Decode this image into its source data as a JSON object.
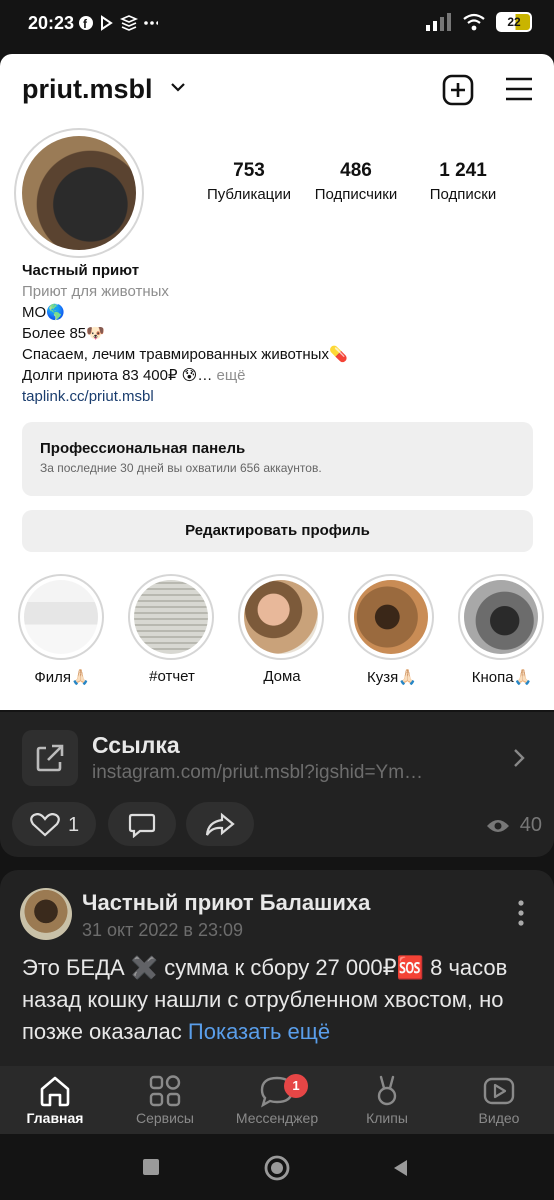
{
  "status_bar": {
    "time": "20:23",
    "battery": "22",
    "icons": [
      "facebook-icon",
      "play-icon",
      "layers-icon",
      "more-dots-icon",
      "signal-icon",
      "wifi-icon",
      "battery-icon"
    ]
  },
  "instagram": {
    "username": "priut.msbl",
    "stats": [
      {
        "value": "753",
        "label": "Публикации"
      },
      {
        "value": "486",
        "label": "Подписчики"
      },
      {
        "value": "1 241",
        "label": "Подписки"
      }
    ],
    "bio": {
      "name": "Частный приют",
      "category": "Приют для животных",
      "line1": "МО🌎",
      "line2": "Более 85🐶",
      "line3": "Спасаем, лечим травмированных животных💊",
      "line4": "Долги приюта 83 400₽ 😰…",
      "more": " ещё",
      "link": "taplink.cc/priut.msbl"
    },
    "pro_panel": {
      "title": "Профессиональная панель",
      "subtitle": "За последние 30 дней вы охватили 656 аккаунтов."
    },
    "edit_profile": "Редактировать профиль",
    "highlights": [
      {
        "label": "Филя🙏🏻"
      },
      {
        "label": "#отчет"
      },
      {
        "label": "Дома"
      },
      {
        "label": "Кузя🙏🏻"
      },
      {
        "label": "Кнопа🙏🏻"
      }
    ]
  },
  "link_card": {
    "title": "Ссылка",
    "url": "instagram.com/priut.msbl?igshid=Ym…",
    "likes": "1",
    "views": "40"
  },
  "post": {
    "author": "Частный приют Балашиха",
    "date": "31 окт 2022 в 23:09",
    "text": "Это БЕДА ✖️ сумма к сбору 27 000₽🆘 8 часов назад кошку нашли с отрубленном хвостом, но позже оказалас",
    "show_more": "Показать ещё"
  },
  "tabbar": {
    "items": [
      {
        "label": "Главная",
        "icon": "home-icon",
        "active": true
      },
      {
        "label": "Сервисы",
        "icon": "services-icon"
      },
      {
        "label": "Мессенджер",
        "icon": "messenger-icon",
        "badge": "1"
      },
      {
        "label": "Клипы",
        "icon": "clips-icon"
      },
      {
        "label": "Видео",
        "icon": "video-icon"
      }
    ]
  },
  "colors": {
    "accent_link": "#5a9eea",
    "badge": "#e64646",
    "dark_bg": "#222222"
  }
}
